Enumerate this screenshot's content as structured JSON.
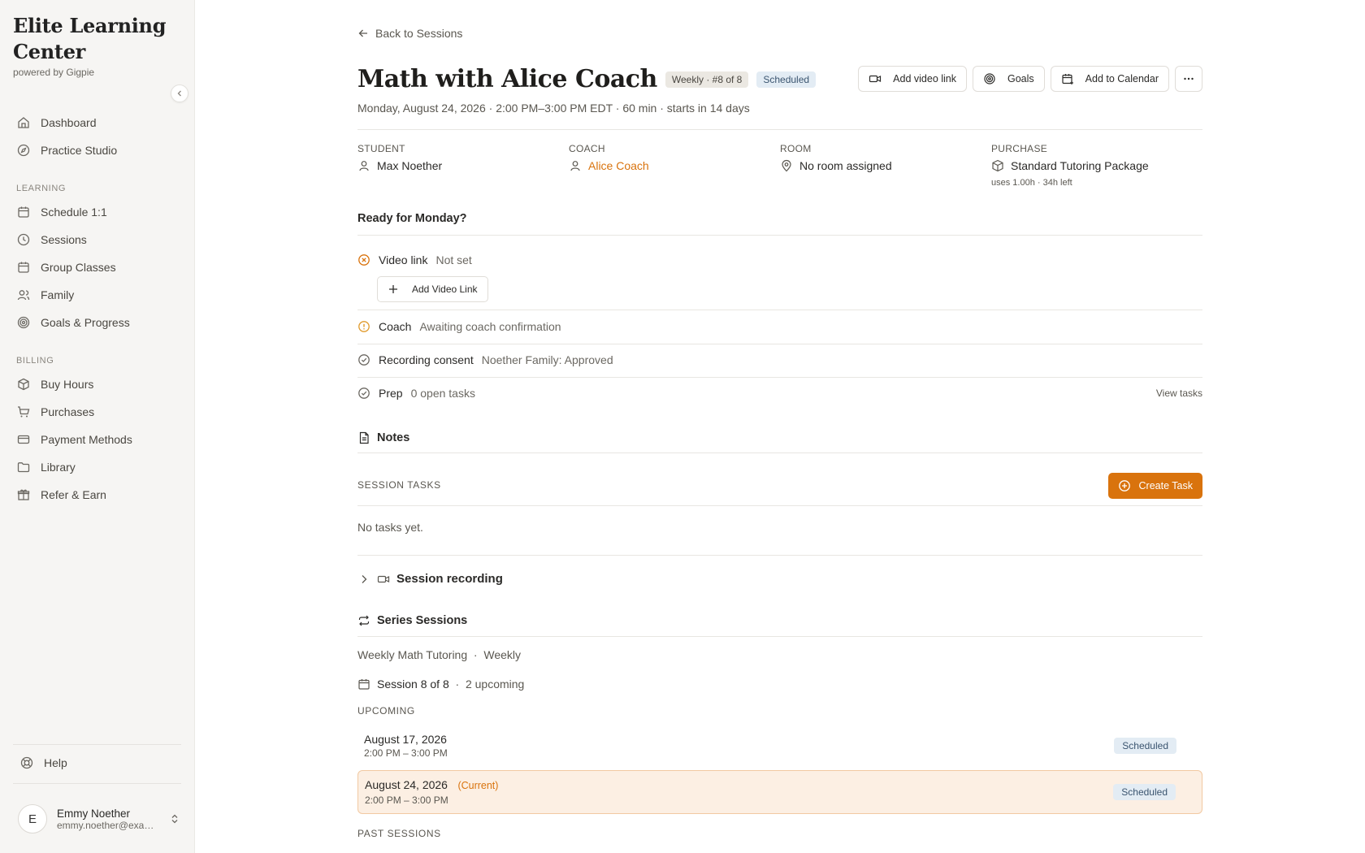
{
  "brand": {
    "name": "Elite Learning Center",
    "tagline": "powered by Gigpie"
  },
  "sidebar": {
    "items_top": [
      {
        "label": "Dashboard",
        "icon": "home-icon"
      },
      {
        "label": "Practice Studio",
        "icon": "compass-icon"
      }
    ],
    "learning_header": "LEARNING",
    "learning_items": [
      {
        "label": "Schedule 1:1",
        "icon": "calendar-icon"
      },
      {
        "label": "Sessions",
        "icon": "clock-icon"
      },
      {
        "label": "Group Classes",
        "icon": "calendar-icon"
      },
      {
        "label": "Family",
        "icon": "users-icon"
      },
      {
        "label": "Goals & Progress",
        "icon": "target-icon"
      }
    ],
    "billing_header": "BILLING",
    "billing_items": [
      {
        "label": "Buy Hours",
        "icon": "package-icon"
      },
      {
        "label": "Purchases",
        "icon": "cart-icon"
      },
      {
        "label": "Payment Methods",
        "icon": "credit-card-icon"
      },
      {
        "label": "Library",
        "icon": "folder-icon"
      },
      {
        "label": "Refer & Earn",
        "icon": "gift-icon"
      }
    ],
    "help": "Help",
    "user": {
      "initial": "E",
      "name": "Emmy Noether",
      "email": "emmy.noether@example.com"
    }
  },
  "page": {
    "back": "Back to Sessions",
    "title": "Math with Alice Coach",
    "recurrence_pill": "Weekly · #8 of 8",
    "status_pill": "Scheduled",
    "subtitle": "Monday, August 24, 2026 · 2:00 PM–3:00 PM EDT · 60 min · starts in 14 days",
    "actions": {
      "video": "Add video link",
      "goals": "Goals",
      "calendar": "Add to Calendar"
    }
  },
  "info": {
    "student_label": "STUDENT",
    "student": "Max Noether",
    "coach_label": "COACH",
    "coach": "Alice Coach",
    "room_label": "ROOM",
    "room": "No room assigned",
    "purchase_label": "PURCHASE",
    "purchase": "Standard Tutoring Package",
    "purchase_sub": "uses 1.00h · 34h left"
  },
  "readiness": {
    "heading": "Ready for Monday?",
    "video_k": "Video link",
    "video_v": "Not set",
    "add_video": "Add Video Link",
    "coach_k": "Coach",
    "coach_v": "Awaiting coach confirmation",
    "consent_k": "Recording consent",
    "consent_v": "Noether Family: Approved",
    "prep_k": "Prep",
    "prep_v": "0 open tasks",
    "view_tasks": "View tasks"
  },
  "notes": {
    "heading": "Notes"
  },
  "tasks": {
    "label": "SESSION TASKS",
    "create": "Create Task",
    "empty": "No tasks yet."
  },
  "recording": {
    "heading": "Session recording"
  },
  "series": {
    "heading": "Series Sessions",
    "name": "Weekly Math Tutoring",
    "freq": "Weekly",
    "count": "Session 8 of 8",
    "upcoming_count": "2 upcoming",
    "upcoming_label": "UPCOMING",
    "past_label": "PAST SESSIONS",
    "sessions": [
      {
        "date": "August 17, 2026",
        "time": "2:00 PM – 3:00 PM",
        "status": "Scheduled",
        "current": ""
      },
      {
        "date": "August 24, 2026",
        "time": "2:00 PM – 3:00 PM",
        "status": "Scheduled",
        "current": "(Current)"
      }
    ]
  },
  "colors": {
    "accent": "#d9730d",
    "sidebar_bg": "#f6f5f3",
    "scheduled_bg": "#e3ecf4"
  }
}
